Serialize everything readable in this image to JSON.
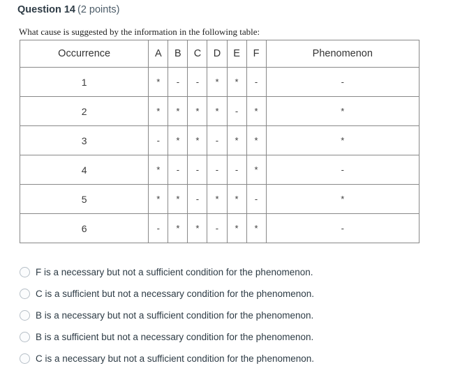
{
  "question": {
    "title": "Question 14",
    "points": "(2 points)",
    "prompt": "What cause is suggested by the information in the following table:"
  },
  "table": {
    "headers": {
      "occurrence": "Occurrence",
      "letters": [
        "A",
        "B",
        "C",
        "D",
        "E",
        "F"
      ],
      "phenomenon": "Phenomenon"
    },
    "rows": [
      {
        "occurrence": "1",
        "values": [
          "*",
          "-",
          "-",
          "*",
          "*",
          "-"
        ],
        "phenomenon": "-"
      },
      {
        "occurrence": "2",
        "values": [
          "*",
          "*",
          "*",
          "*",
          "-",
          "*"
        ],
        "phenomenon": "*"
      },
      {
        "occurrence": "3",
        "values": [
          "-",
          "*",
          "*",
          "-",
          "*",
          "*"
        ],
        "phenomenon": "*"
      },
      {
        "occurrence": "4",
        "values": [
          "*",
          "-",
          "-",
          "-",
          "-",
          "*"
        ],
        "phenomenon": "-"
      },
      {
        "occurrence": "5",
        "values": [
          "*",
          "*",
          "-",
          "*",
          "*",
          "-"
        ],
        "phenomenon": "*"
      },
      {
        "occurrence": "6",
        "values": [
          "-",
          "*",
          "*",
          "-",
          "*",
          "*"
        ],
        "phenomenon": "-"
      }
    ]
  },
  "options": [
    {
      "label": "F is a necessary but not a sufficient condition for the phenomenon.",
      "selected": false
    },
    {
      "label": "C is a sufficient but not a necessary condition for the phenomenon.",
      "selected": false
    },
    {
      "label": "B is a necessary but not a sufficient condition for the phenomenon.",
      "selected": false
    },
    {
      "label": "B is a sufficient but not a necessary condition for the phenomenon.",
      "selected": false
    },
    {
      "label": "C is a necessary but not a sufficient condition for the phenomenon.",
      "selected": false
    }
  ],
  "colors": {
    "text": "#2d3b45",
    "table_border": "#1c1c1c",
    "grid_line": "#888888",
    "radio_border": "#b6bfc7"
  }
}
